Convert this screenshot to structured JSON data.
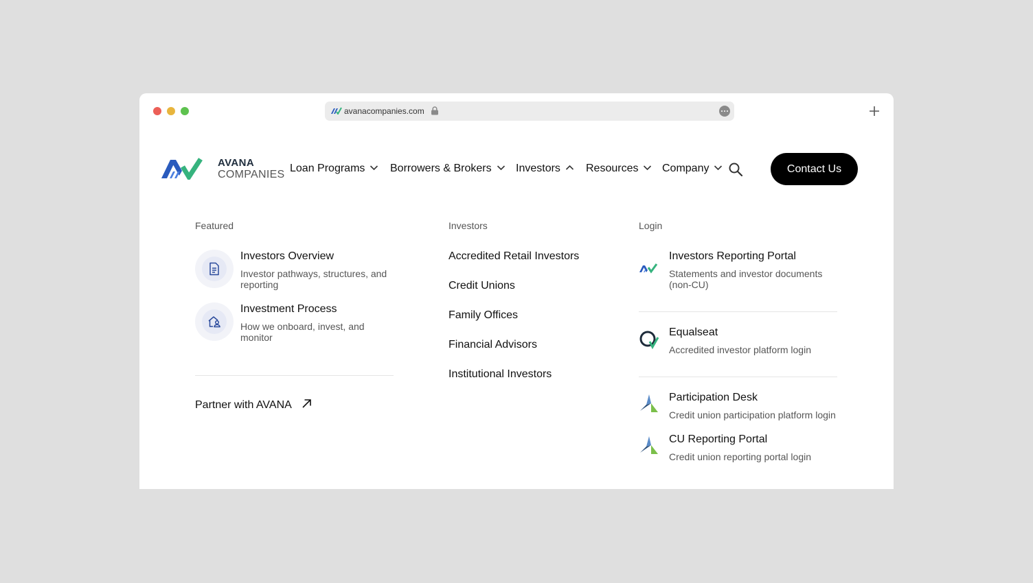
{
  "browser": {
    "url": "avanacompanies.com"
  },
  "brand": {
    "line1": "AVANA",
    "line2": "COMPANIES",
    "colors": {
      "blue": "#2a5bbd",
      "green": "#36b37e"
    }
  },
  "nav": {
    "items": [
      {
        "label": "Loan Programs",
        "state": "collapsed"
      },
      {
        "label": "Borrowers & Brokers",
        "state": "collapsed"
      },
      {
        "label": "Investors",
        "state": "expanded"
      },
      {
        "label": "Resources",
        "state": "collapsed"
      },
      {
        "label": "Company",
        "state": "collapsed"
      }
    ],
    "search_icon": "search-icon",
    "contact_label": "Contact Us"
  },
  "dropdown": {
    "featured": {
      "title": "Featured",
      "items": [
        {
          "title": "Investors Overview",
          "desc": "Investor pathways, structures, and reporting",
          "icon": "document-icon"
        },
        {
          "title": "Investment Process",
          "desc": "How we onboard, invest, and monitor",
          "icon": "house-person-icon"
        }
      ],
      "partner_label": "Partner with AVANA",
      "partner_icon": "arrow-up-right-icon"
    },
    "investors": {
      "title": "Investors",
      "links": [
        "Accredited Retail Investors",
        "Credit Unions",
        "Family Offices",
        "Financial Advisors",
        "Institutional Investors"
      ]
    },
    "login": {
      "title": "Login",
      "items": [
        {
          "title": "Investors Reporting Portal",
          "desc": "Statements and investor documents (non-CU)",
          "icon": "avana-logo-icon"
        },
        {
          "title": "Equalseat",
          "desc": "Accredited investor platform login",
          "icon": "equalseat-logo-icon"
        },
        {
          "title": "Participation Desk",
          "desc": "Credit union participation platform login",
          "icon": "triangle-logo-icon"
        },
        {
          "title": "CU Reporting Portal",
          "desc": "Credit union reporting portal login",
          "icon": "triangle-logo-icon"
        }
      ]
    }
  }
}
